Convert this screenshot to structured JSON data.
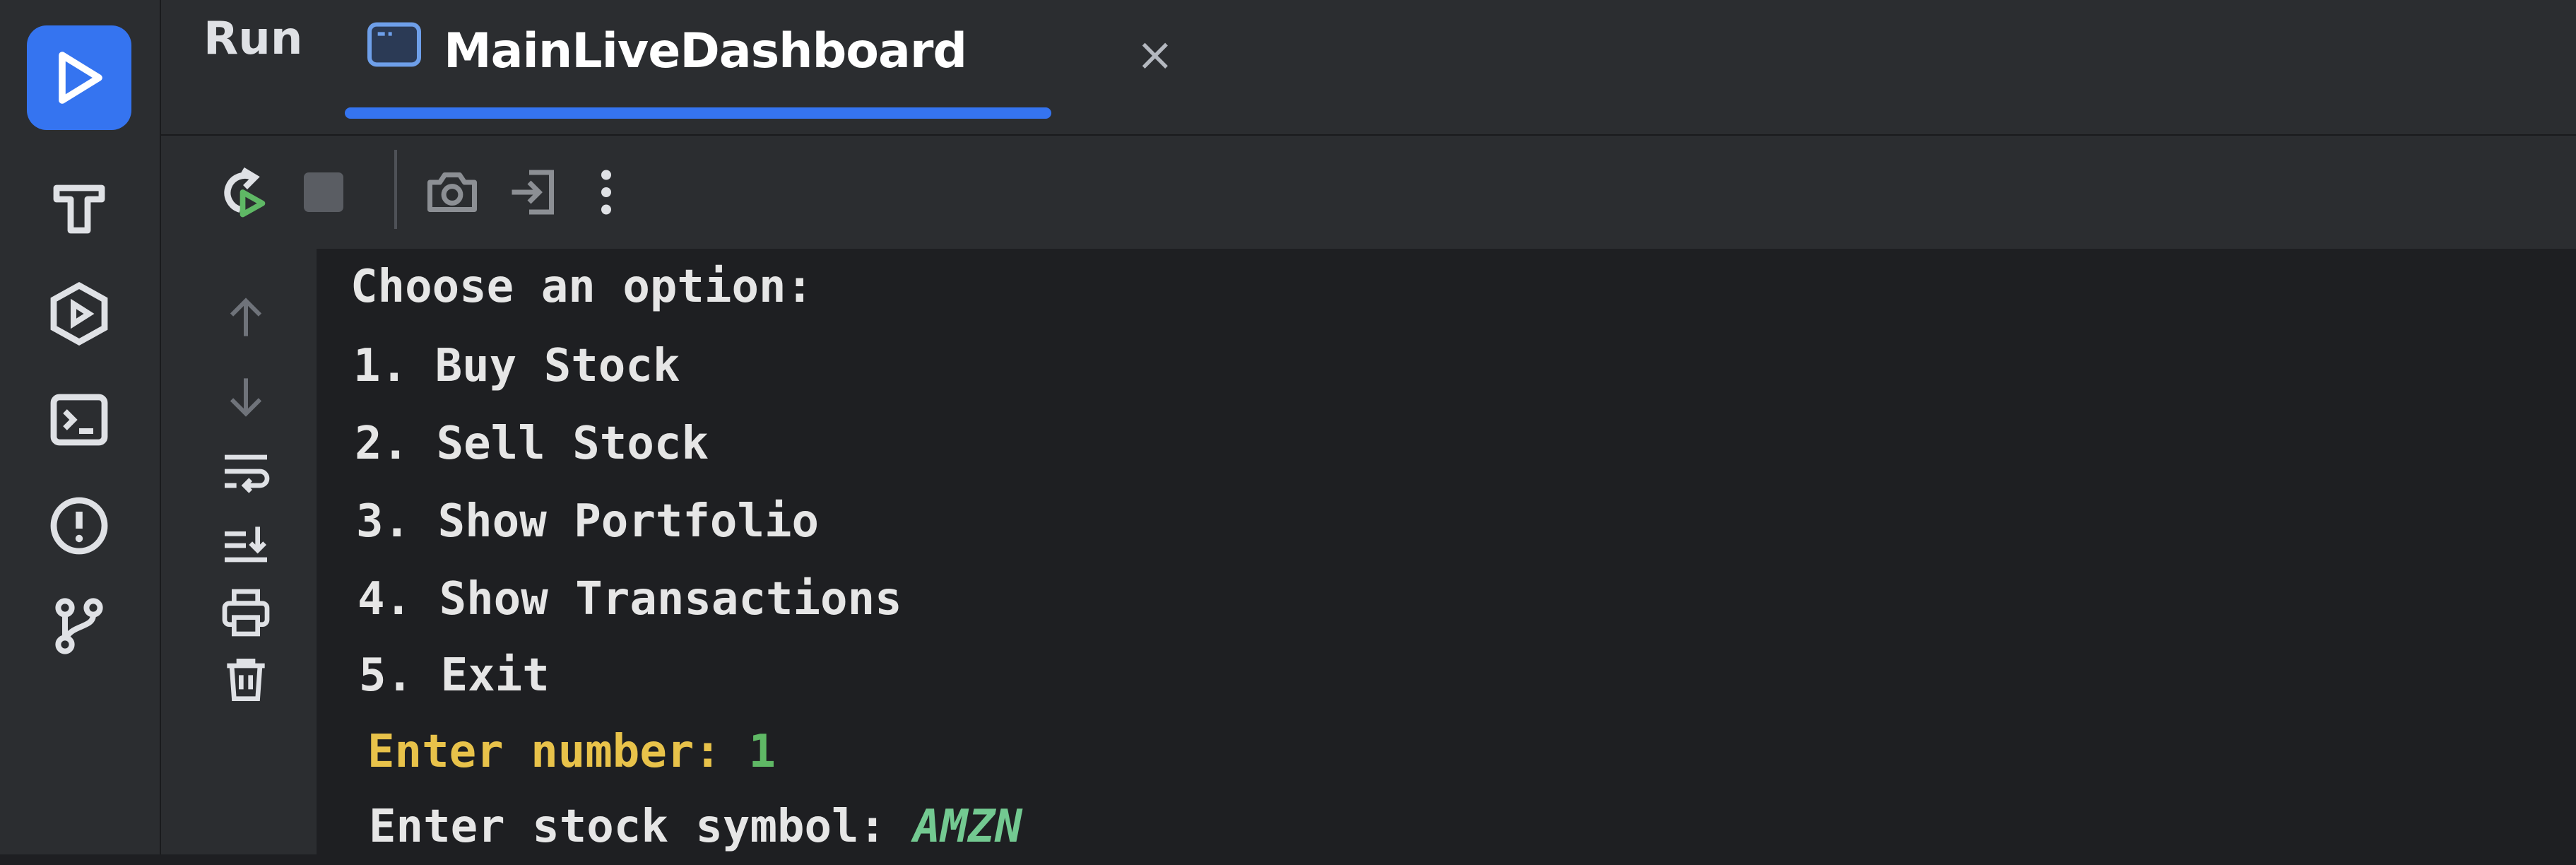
{
  "run_panel": {
    "title": "Run",
    "tab": {
      "label": "MainLiveDashboard",
      "close": "×"
    }
  },
  "left_bar": {
    "icons": [
      "run-icon",
      "build-hammer-icon",
      "services-icon",
      "terminal-icon",
      "problems-icon",
      "git-icon"
    ]
  },
  "toolbar": {
    "icons": [
      "rerun-icon",
      "stop-icon",
      "screenshot-icon",
      "exit-login-icon",
      "more-options-icon"
    ]
  },
  "gutter": {
    "icons": [
      "scroll-up-icon",
      "scroll-down-icon",
      "soft-wrap-icon",
      "scroll-to-end-icon",
      "print-icon",
      "clear-all-icon"
    ]
  },
  "console": {
    "menu_header": "Choose an option:",
    "options": [
      "1. Buy Stock",
      "2. Sell Stock",
      "3. Show Portfolio",
      "4. Show Transactions",
      "5. Exit"
    ],
    "prompt1_label": "Enter number: ",
    "prompt1_value": "1",
    "prompt2_label": "Enter stock symbol: ",
    "prompt2_value": "AMZN"
  },
  "colors": {
    "accent": "#3574f0",
    "prompt_yellow": "#e8c24a",
    "input_green": "#73c991"
  }
}
